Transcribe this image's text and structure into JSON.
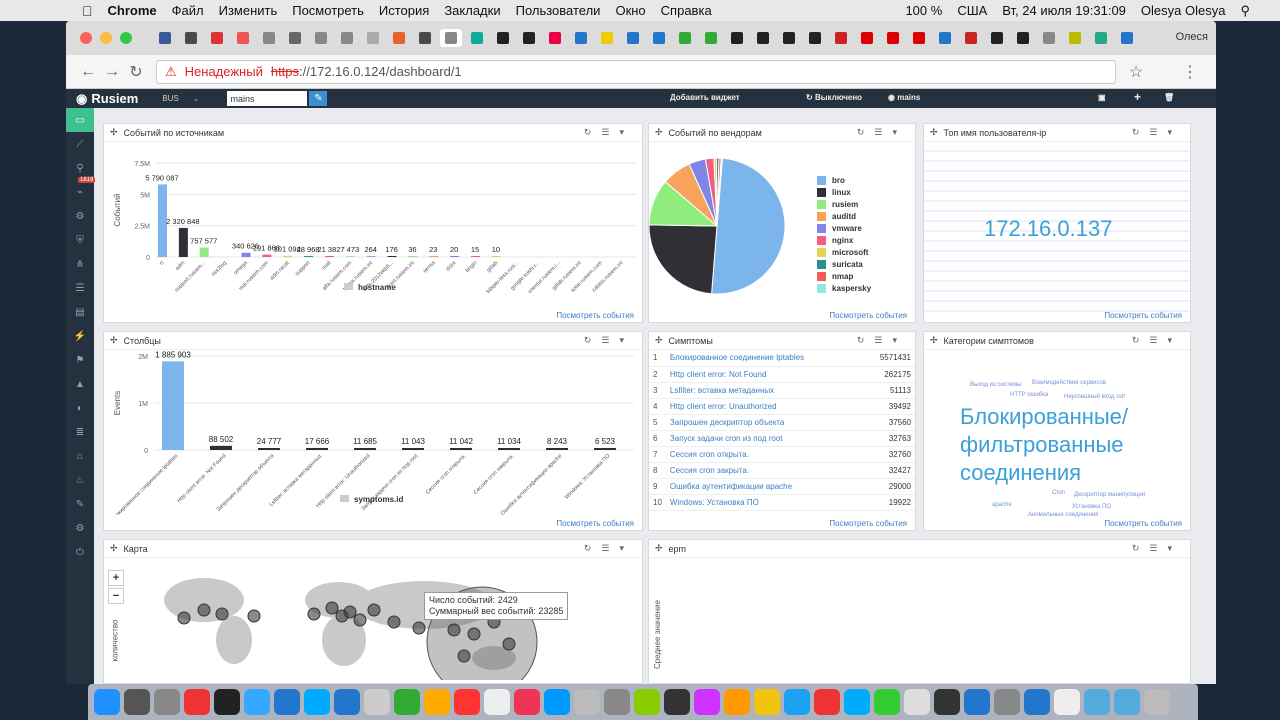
{
  "menubar": {
    "app": "Chrome",
    "items": [
      "Файл",
      "Изменить",
      "Посмотреть",
      "История",
      "Закладки",
      "Пользователи",
      "Окно",
      "Справка"
    ],
    "battery": "100 %",
    "locale": "США",
    "datetime": "Вт, 24 июля  19:31:09",
    "user": "Olesya Olesya"
  },
  "browser": {
    "profile": "Олеся",
    "url_warning": "Ненадежный",
    "url_scheme": "https",
    "url_rest": "://172.16.0.124/dashboard/1"
  },
  "app": {
    "brand": "Rusiem",
    "bus": "BUS",
    "search_value": "mains",
    "add_widget": "Добавить виджет",
    "off_label": "Выключено",
    "filter_label": "mains",
    "badge": "1819"
  },
  "colors": {
    "bro": "#7cb5ec",
    "linux": "#2f2f35",
    "rusiem": "#90ed7d",
    "auditd": "#f7a35c",
    "vmware": "#8085e9",
    "nginx": "#f15c80",
    "microsoft": "#e4d354",
    "suricata": "#2b908f",
    "nmap": "#f45b5b",
    "kaspersky": "#91e8e1"
  },
  "common": {
    "more_link": "Посмотреть события"
  },
  "panels": {
    "sources": {
      "title": "Событий по источникам",
      "ylabel": "Событий",
      "legend": "hostname"
    },
    "vendors": {
      "title": "Событий по вендорам"
    },
    "topusers": {
      "title": "Топ имя пользователя-ip",
      "highlight": "172.16.0.137"
    },
    "columns": {
      "title": "Столбцы",
      "ylabel": "Events",
      "legend": "symptoms.id"
    },
    "symptoms": {
      "title": "Симптомы",
      "rows": [
        {
          "n": "1",
          "label": "Блокированное соединение Iptables",
          "value": "5571431"
        },
        {
          "n": "2",
          "label": "Http client error: Not Found",
          "value": "262175"
        },
        {
          "n": "3",
          "label": "Lsfilter: вставка метаданных",
          "value": "51113"
        },
        {
          "n": "4",
          "label": "Http client error: Unauthorized",
          "value": "39492"
        },
        {
          "n": "5",
          "label": "Запрошен дескриптор объекта",
          "value": "37560"
        },
        {
          "n": "6",
          "label": "Запуск задачи cron из под root",
          "value": "32763"
        },
        {
          "n": "7",
          "label": "Сессия cron открыта.",
          "value": "32760"
        },
        {
          "n": "8",
          "label": "Сессия cron закрыта.",
          "value": "32427"
        },
        {
          "n": "9",
          "label": "Ошибка аутентификации apache",
          "value": "29000"
        },
        {
          "n": "10",
          "label": "Windows: Установка ПО",
          "value": "19922"
        }
      ]
    },
    "categories": {
      "title": "Категории симптомов",
      "big1": "Блокированные/",
      "big2": "фильтрованные",
      "big3": "соединения",
      "small": [
        "Выход из системы",
        "Взаимодействие сервисов",
        "HTTP ошибка",
        "Неуспешный вход ssh",
        "Cron",
        "Дескриптор манипуляции",
        "apache",
        "Установка ПО",
        "Аномальные соединения"
      ]
    },
    "map": {
      "title": "Карта",
      "zoom_in": "+",
      "zoom_out": "−",
      "ylabel": "количество",
      "tooltip1": "Число событий: 2429",
      "tooltip2": "Суммарный вес событий: 23285"
    },
    "epm": {
      "title": "epm",
      "ylabel": "Среднее значение"
    }
  },
  "chart_data": [
    {
      "type": "bar",
      "title": "Событий по источникам",
      "ylabel": "Событий",
      "ylim": [
        0,
        7500000
      ],
      "yticks": [
        "0",
        "2.5M",
        "5M",
        "7.5M"
      ],
      "categories": [
        "rt",
        "adm",
        "support.rusiem...",
        "oss2log",
        "omega",
        "mai.rusiem.com",
        "adm.racat",
        "support",
        "mail",
        "alfa.rusiem.com",
        "terma.rusiem.int",
        "wrfs-2012ekb6...",
        "dcint.rusiem.int",
        "terma",
        "dcint",
        "bngin",
        "gitlab",
        "kibiper-tess.rusi...",
        "google.sushi.r...",
        "voentur.rusiem.i...",
        "gitlab.rusiem.int",
        "solar.rusiem.com",
        "zabbix.rusiem.int"
      ],
      "series": [
        {
          "name": "hostname",
          "values": [
            5790087,
            2320848,
            757577,
            0,
            340626,
            191868,
            101094,
            28968,
            21382,
            7473,
            264,
            176,
            36,
            23,
            20,
            15,
            10
          ]
        }
      ],
      "labels": [
        "5 790 087",
        "2 320 848",
        "757 577",
        "",
        "340 626",
        "191 868",
        "101 094",
        "28 968",
        "21 382",
        "7 473",
        "264",
        "176",
        "36",
        "23",
        "20",
        "15",
        "10"
      ],
      "bar_colors": [
        "#7cb5ec",
        "#2f2f35",
        "#90ed7d",
        "#f7a35c",
        "#8085e9",
        "#f15c80",
        "#e4d354",
        "#2b908f",
        "#f45b5b",
        "#91e8e1",
        "#7cb5ec",
        "#2f2f35",
        "#90ed7d",
        "#f7a35c",
        "#8085e9",
        "#f15c80",
        "#e4d354"
      ]
    },
    {
      "type": "pie",
      "title": "Событий по вендорам",
      "categories": [
        "bro",
        "linux",
        "rusiem",
        "auditd",
        "vmware",
        "nginx",
        "microsoft",
        "suricata",
        "nmap",
        "kaspersky"
      ],
      "values": [
        50,
        24,
        11,
        7,
        4,
        2,
        0.6,
        0.6,
        0.5,
        0.3
      ]
    },
    {
      "type": "bar",
      "title": "Столбцы",
      "ylabel": "Events",
      "ylim": [
        0,
        2000000
      ],
      "yticks": [
        "0",
        "1M",
        "2M"
      ],
      "categories": [
        "Блокированное соединение Iptables",
        "Http client error: Not Found",
        "Запрошен дескриптор объекта",
        "Lsfilter: вставка метаданных",
        "Http client error: Unauthorized",
        "Запуск задачи cron из под root",
        "Сессия cron открыта.",
        "Сессия cron закрыта.",
        "Ошибка аутентификации apache",
        "Windows: Установка ПО"
      ],
      "series": [
        {
          "name": "symptoms.id",
          "values": [
            1885903,
            88502,
            24777,
            17666,
            11685,
            11043,
            11042,
            11034,
            8243,
            6523
          ]
        }
      ],
      "labels": [
        "1 885 903",
        "88 502",
        "24 777",
        "17 666",
        "11 685",
        "11 043",
        "11 042",
        "11 034",
        "8 243",
        "6 523"
      ]
    }
  ]
}
